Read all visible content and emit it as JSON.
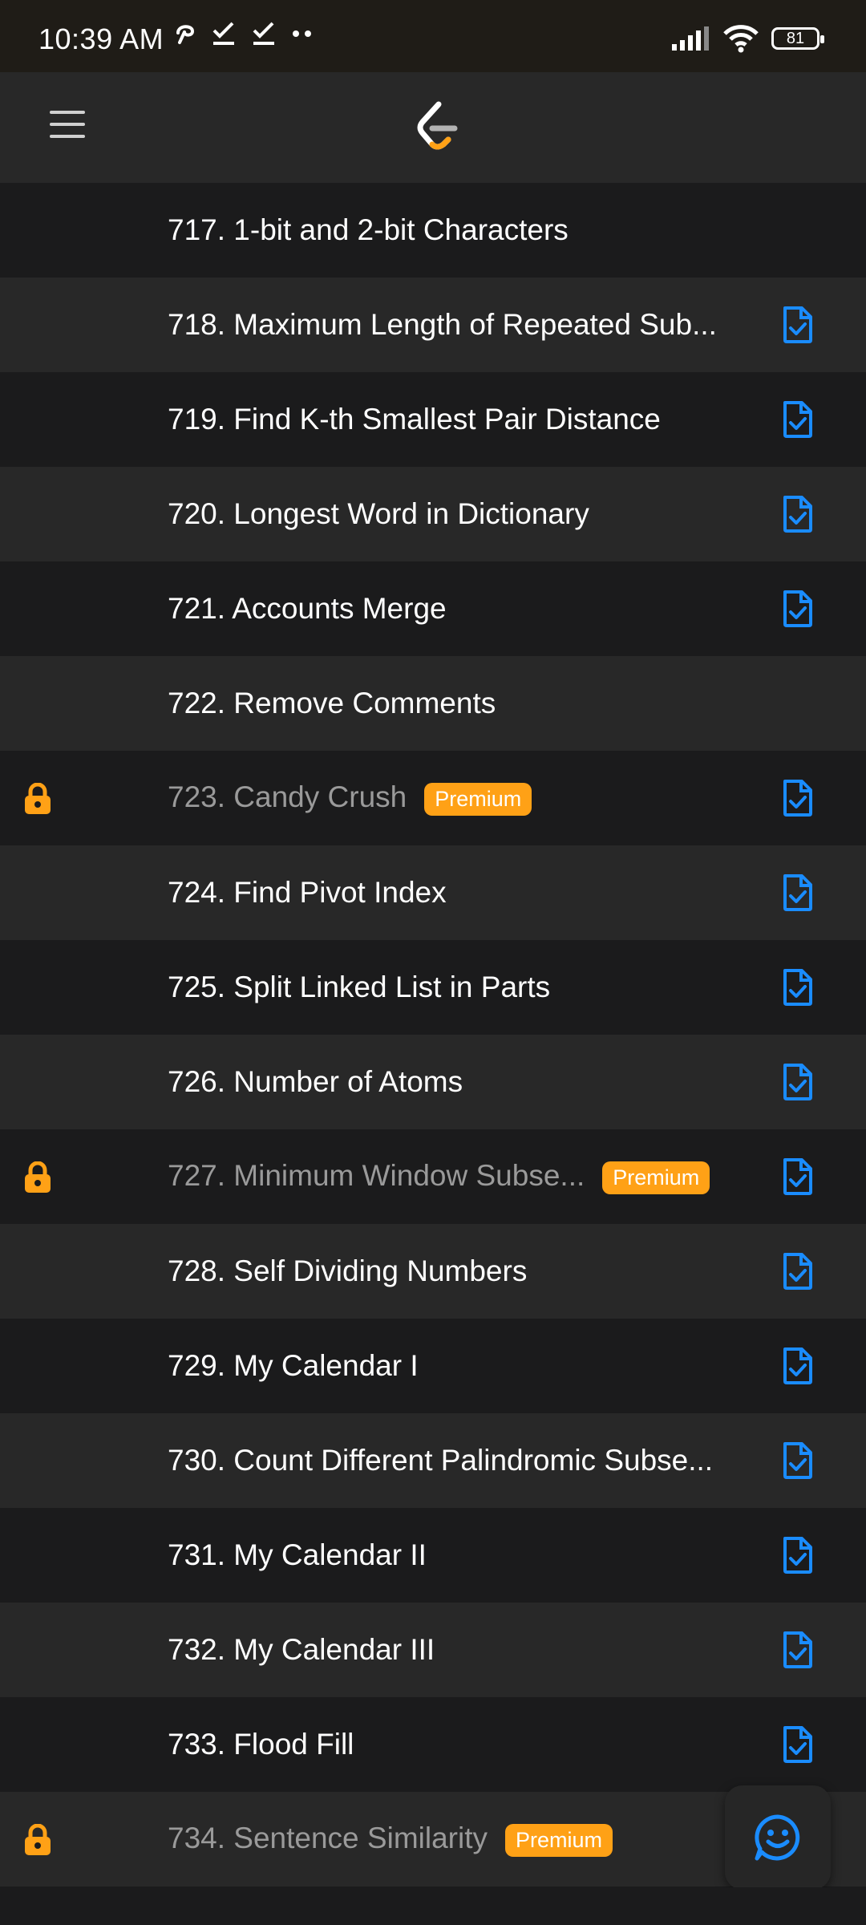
{
  "status_bar": {
    "time": "10:39 AM",
    "battery": "81"
  },
  "colors": {
    "accent_blue": "#1a8cff",
    "premium_orange": "#ffa116",
    "row_dark": "#1b1b1c",
    "row_light": "#282828"
  },
  "header": {
    "menu_icon": "hamburger-icon",
    "logo_icon": "leetcode-logo"
  },
  "problems": [
    {
      "title": "717. 1-bit and 2-bit Characters",
      "premium": false,
      "solution": false
    },
    {
      "title": "718. Maximum Length of Repeated Sub...",
      "premium": false,
      "solution": true
    },
    {
      "title": "719. Find K-th Smallest Pair Distance",
      "premium": false,
      "solution": true
    },
    {
      "title": "720. Longest Word in Dictionary",
      "premium": false,
      "solution": true
    },
    {
      "title": "721. Accounts Merge",
      "premium": false,
      "solution": true
    },
    {
      "title": "722. Remove Comments",
      "premium": false,
      "solution": false
    },
    {
      "title": "723. Candy Crush",
      "premium": true,
      "solution": true
    },
    {
      "title": "724. Find Pivot Index",
      "premium": false,
      "solution": true
    },
    {
      "title": "725. Split Linked List in Parts",
      "premium": false,
      "solution": true
    },
    {
      "title": "726. Number of Atoms",
      "premium": false,
      "solution": true
    },
    {
      "title": "727. Minimum Window Subse...",
      "premium": true,
      "solution": true
    },
    {
      "title": "728. Self Dividing Numbers",
      "premium": false,
      "solution": true
    },
    {
      "title": "729. My Calendar I",
      "premium": false,
      "solution": true
    },
    {
      "title": "730. Count Different Palindromic Subse...",
      "premium": false,
      "solution": true
    },
    {
      "title": "731. My Calendar II",
      "premium": false,
      "solution": true
    },
    {
      "title": "732. My Calendar III",
      "premium": false,
      "solution": true
    },
    {
      "title": "733. Flood Fill",
      "premium": false,
      "solution": true
    },
    {
      "title": "734. Sentence Similarity",
      "premium": true,
      "solution": false
    }
  ],
  "premium_label": "Premium",
  "fab_icon": "smiley-chat-icon"
}
